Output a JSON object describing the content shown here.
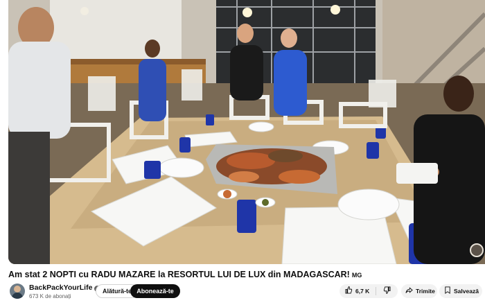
{
  "video": {
    "title": "Am stat 2 NOPTI cu RADU MAZARE la RESORTUL LUI DE LUX din MADAGASCAR!",
    "title_badge": "MG"
  },
  "channel": {
    "name": "BackPackYourLife",
    "subscribers": "673 K de abonați",
    "join_label": "Alătură-te",
    "subscribe_label": "Abonează-te"
  },
  "actions": {
    "like_count": "6,7 K",
    "share_label": "Trimite",
    "save_label": "Salvează",
    "more_label": "⋯"
  },
  "icons": {
    "like": "thumbs-up-icon",
    "dislike": "thumbs-down-icon",
    "share": "share-arrow-icon",
    "save": "bookmark-icon",
    "verified": "verified-check-icon"
  }
}
